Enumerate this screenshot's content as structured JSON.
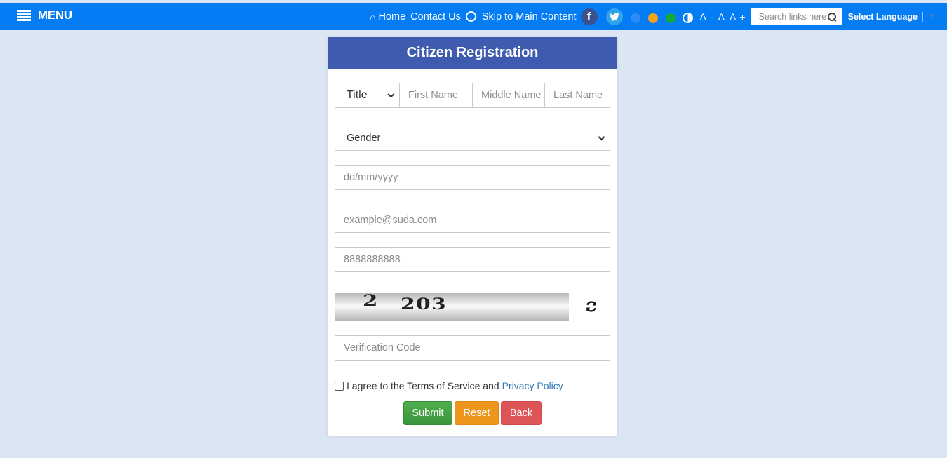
{
  "navbar": {
    "menu_label": "MENU",
    "links": [
      {
        "label": "Home",
        "icon": "home-icon"
      },
      {
        "label": "Contact Us"
      },
      {
        "label": "Skip to Main Content",
        "icon": "download-circle-icon"
      }
    ],
    "social": {
      "facebook": "f",
      "twitter": "t"
    },
    "theme_colors": [
      "#2a8cf7",
      "#f5a11a",
      "#14a83e"
    ],
    "font_controls": [
      "A -",
      "A",
      "A +"
    ],
    "search_placeholder": "Search links here",
    "language_label": "Select Language",
    "accent_color": "#047cf4"
  },
  "form": {
    "title": "Citizen Registration",
    "header_color": "#3f5baf",
    "title_select": "Title",
    "first_name_placeholder": "First Name",
    "middle_name_placeholder": "Middle Name",
    "last_name_placeholder": "Last Name",
    "gender_select": "Gender",
    "dob_placeholder": "dd/mm/yyyy",
    "email_placeholder": "example@suda.com",
    "phone_placeholder": "8888888888",
    "captcha": {
      "part1": "2",
      "part2": "203"
    },
    "verification_placeholder": "Verification Code",
    "agree_text": "I agree to the Terms of Service and",
    "privacy_link": "Privacy Policy",
    "buttons": {
      "submit": "Submit",
      "reset": "Reset",
      "back": "Back"
    }
  }
}
